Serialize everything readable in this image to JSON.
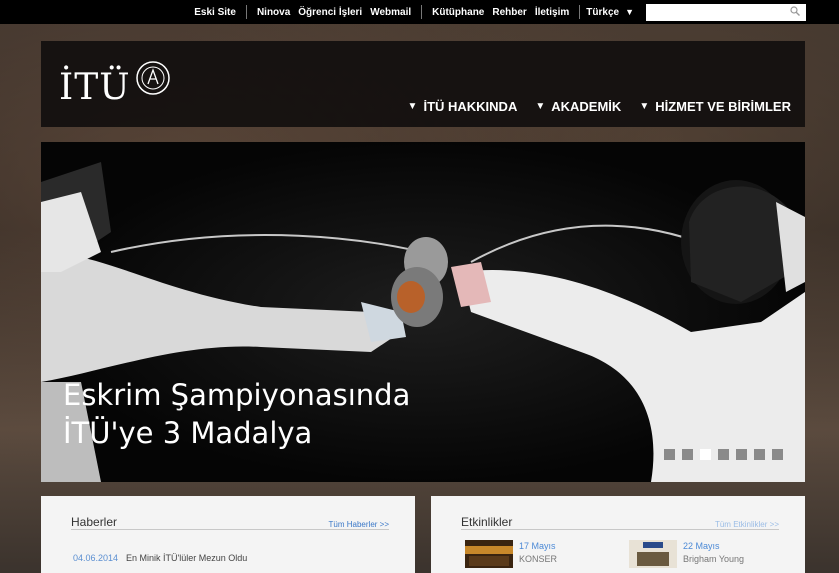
{
  "topbar": {
    "links": [
      "Eski Site",
      "Ninova",
      "Öğrenci İşleri",
      "Webmail",
      "Kütüphane",
      "Rehber",
      "İletişim"
    ],
    "language": "Türkçe",
    "search_placeholder": ""
  },
  "header": {
    "logo_text": "İTÜ",
    "nav": [
      "İTÜ HAKKINDA",
      "AKADEMİK",
      "HİZMET VE BİRİMLER"
    ]
  },
  "hero": {
    "headline_line1": "Eskrim Şampiyonasında",
    "headline_line2": "İTÜ'ye 3 Madalya",
    "slides": 7,
    "active_slide": 3
  },
  "news": {
    "title": "Haberler",
    "more": "Tüm Haberler >>",
    "items": [
      {
        "date": "04.06.2014",
        "title": "En Minik İTÜ'lüler Mezun Oldu"
      }
    ]
  },
  "events": {
    "title": "Etkinlikler",
    "more": "Tüm Etkinlikler >>",
    "items": [
      {
        "date": "17 Mayıs",
        "subtitle": "KONSER"
      },
      {
        "date": "22 Mayıs",
        "subtitle": "Brigham Young"
      }
    ]
  },
  "colors": {
    "accent": "#3a78c8",
    "topbar": "#000000",
    "panel": "#f4f4f4"
  },
  "icons": {
    "search": "magnifier-icon",
    "dropdown": "triangle-down-icon",
    "seal": "itu-seal-icon"
  }
}
